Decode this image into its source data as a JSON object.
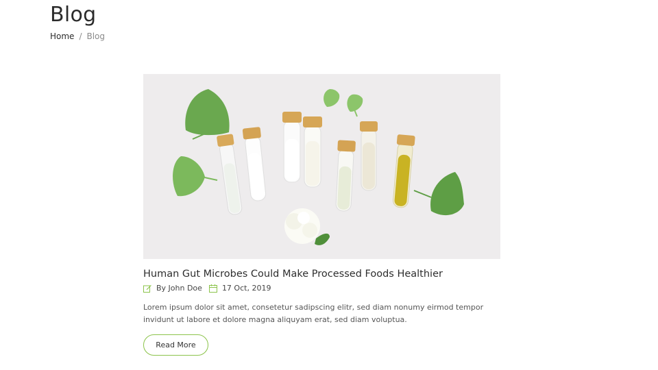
{
  "header": {
    "title": "Blog",
    "breadcrumb": {
      "home": "Home",
      "separator": "/",
      "current": "Blog"
    }
  },
  "post": {
    "image_alt": "Glass test tubes with natural extracts and ginkgo leaves",
    "title": "Human Gut Microbes Could Make Processed Foods Healthier",
    "author": "By John Doe",
    "date": "17 Oct, 2019",
    "excerpt": "Lorem ipsum dolor sit amet, consetetur sadipscing elitr, sed diam nonumy eirmod tempor invidunt ut labore et dolore magna aliquyam erat, sed diam voluptua.",
    "read_more_label": "Read More"
  },
  "colors": {
    "accent": "#8bc34a",
    "text": "#2b2b2b",
    "muted": "#8a8a8a"
  },
  "icons": {
    "author": "edit-icon",
    "date": "calendar-icon"
  }
}
